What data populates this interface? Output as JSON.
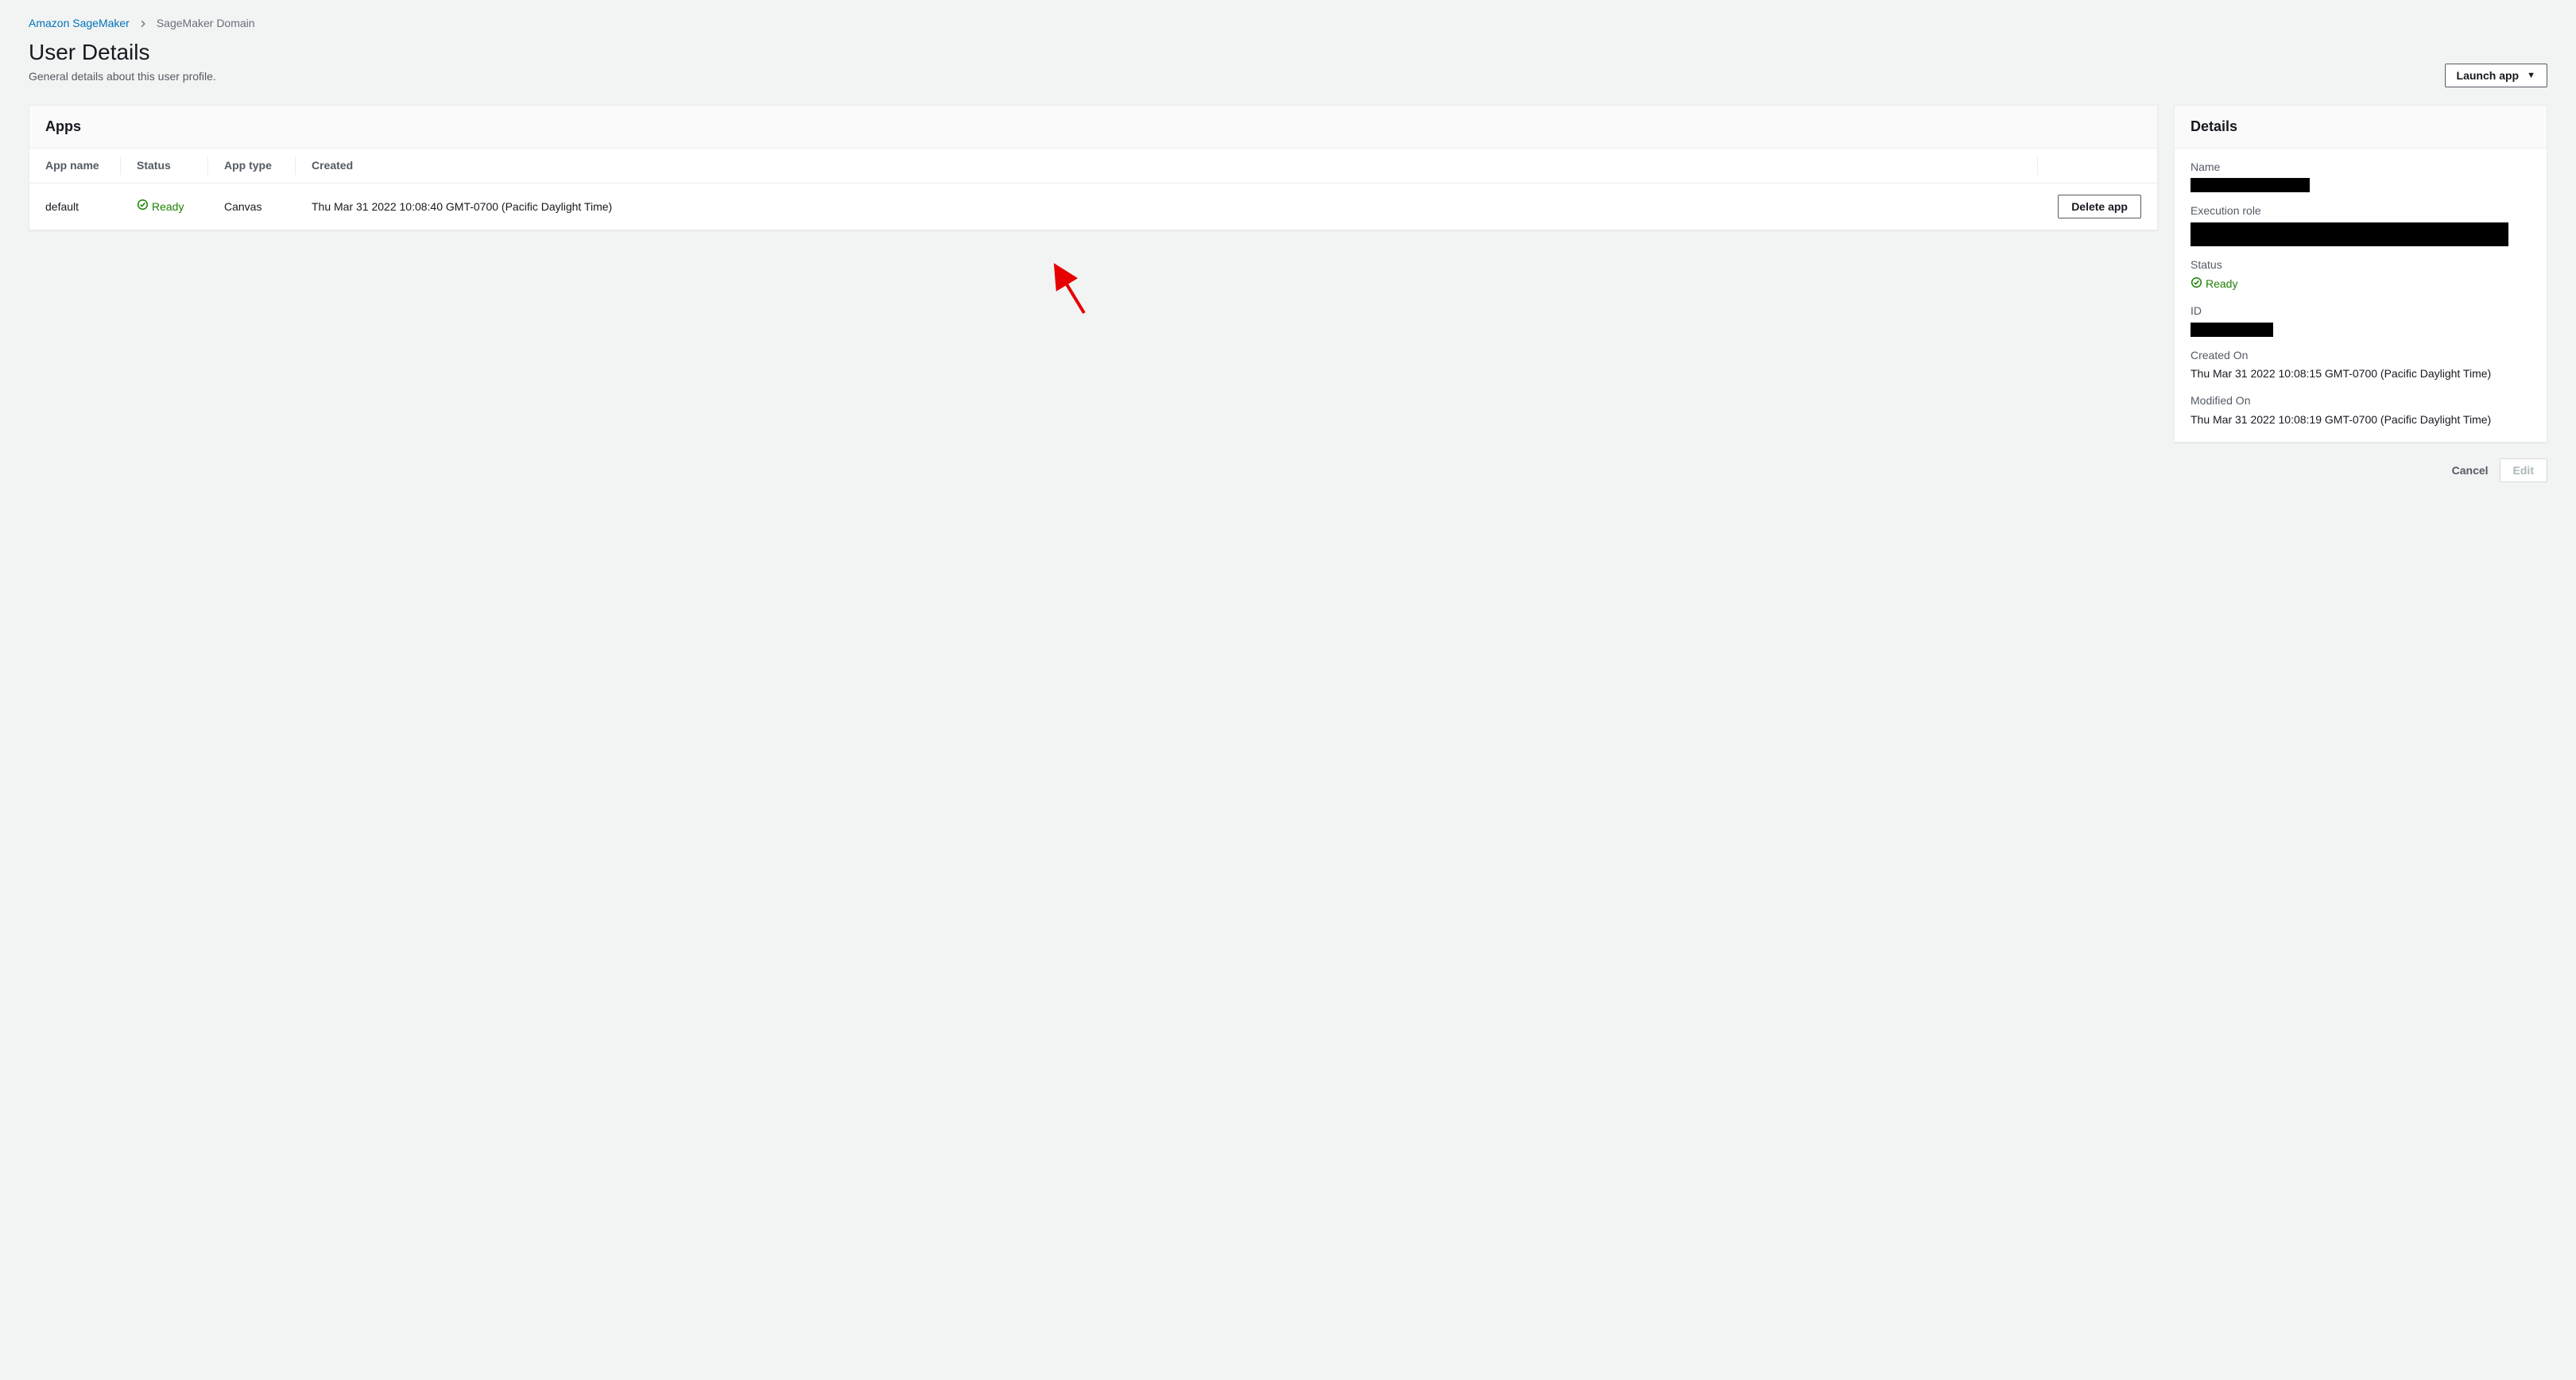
{
  "breadcrumb": {
    "root": "Amazon SageMaker",
    "current": "SageMaker Domain"
  },
  "header": {
    "title": "User Details",
    "subtitle": "General details about this user profile.",
    "launch_label": "Launch app"
  },
  "apps_panel": {
    "title": "Apps",
    "columns": {
      "name": "App name",
      "status": "Status",
      "type": "App type",
      "created": "Created"
    },
    "rows": [
      {
        "name": "default",
        "status": "Ready",
        "type": "Canvas",
        "created": "Thu Mar 31 2022 10:08:40 GMT-0700 (Pacific Daylight Time)",
        "action_label": "Delete app"
      }
    ]
  },
  "details_panel": {
    "title": "Details",
    "labels": {
      "name": "Name",
      "execution_role": "Execution role",
      "status": "Status",
      "id": "ID",
      "created_on": "Created On",
      "modified_on": "Modified On"
    },
    "values": {
      "status": "Ready",
      "created_on": "Thu Mar 31 2022 10:08:15 GMT-0700 (Pacific Daylight Time)",
      "modified_on": "Thu Mar 31 2022 10:08:19 GMT-0700 (Pacific Daylight Time)"
    }
  },
  "footer": {
    "cancel": "Cancel",
    "edit": "Edit"
  }
}
